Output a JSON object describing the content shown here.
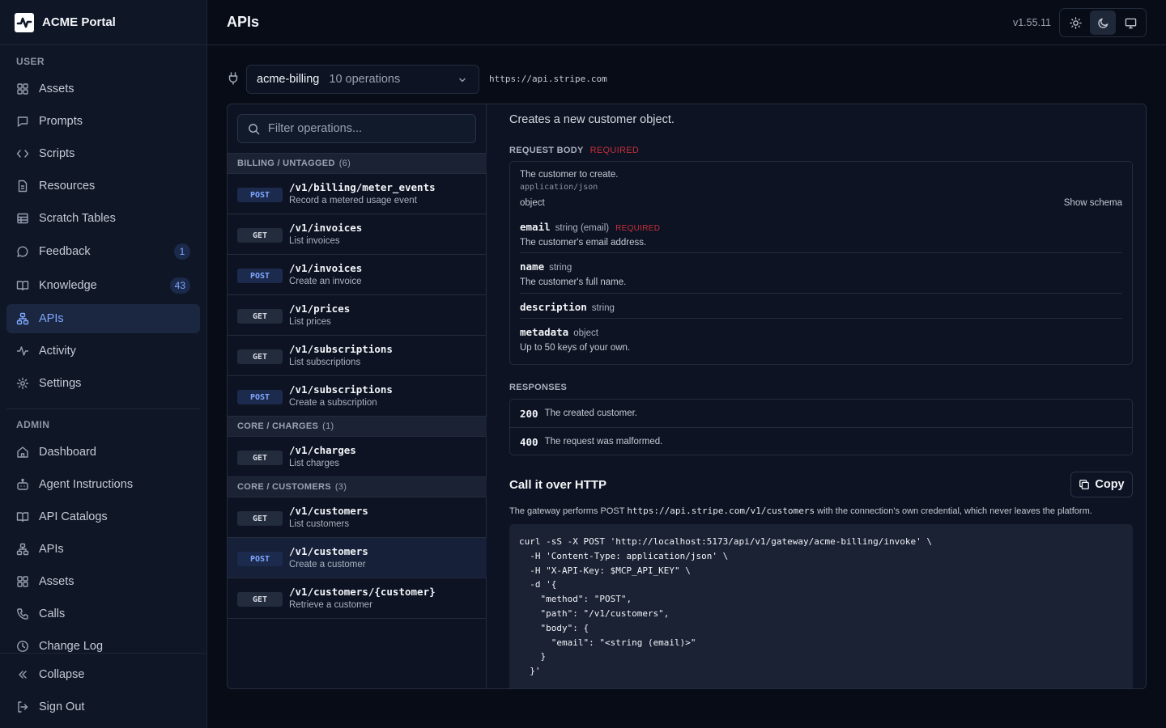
{
  "brand": {
    "name": "ACME Portal"
  },
  "sidebar": {
    "user_section": "USER",
    "admin_section": "ADMIN",
    "user_items": [
      {
        "label": "Assets",
        "icon": "grid-icon"
      },
      {
        "label": "Prompts",
        "icon": "message-icon"
      },
      {
        "label": "Scripts",
        "icon": "code-icon"
      },
      {
        "label": "Resources",
        "icon": "file-icon"
      },
      {
        "label": "Scratch Tables",
        "icon": "table-icon"
      },
      {
        "label": "Feedback",
        "icon": "chat-icon",
        "badge": "1"
      },
      {
        "label": "Knowledge",
        "icon": "book-icon",
        "badge": "43"
      },
      {
        "label": "APIs",
        "icon": "network-icon",
        "active": true
      },
      {
        "label": "Activity",
        "icon": "activity-icon"
      },
      {
        "label": "Settings",
        "icon": "gear-icon"
      }
    ],
    "admin_items": [
      {
        "label": "Dashboard",
        "icon": "home-icon"
      },
      {
        "label": "Agent Instructions",
        "icon": "bot-icon"
      },
      {
        "label": "API Catalogs",
        "icon": "book-icon"
      },
      {
        "label": "APIs",
        "icon": "network-icon"
      },
      {
        "label": "Assets",
        "icon": "grid-icon"
      },
      {
        "label": "Calls",
        "icon": "phone-icon"
      },
      {
        "label": "Change Log",
        "icon": "clock-icon"
      }
    ],
    "collapse_label": "Collapse",
    "signout_label": "Sign Out"
  },
  "header": {
    "title": "APIs",
    "version": "v1.55.11"
  },
  "toolbar": {
    "api_name": "acme-billing",
    "op_count": "10 operations",
    "base_url": "https://api.stripe.com"
  },
  "filter": {
    "placeholder": "Filter operations..."
  },
  "groups": [
    {
      "name": "BILLING / UNTAGGED",
      "count": "(6)"
    },
    {
      "name": "CORE / CHARGES",
      "count": "(1)"
    },
    {
      "name": "CORE / CUSTOMERS",
      "count": "(3)"
    }
  ],
  "operations": [
    {
      "method": "POST",
      "path": "/v1/billing/meter_events",
      "desc": "Record a metered usage event"
    },
    {
      "method": "GET",
      "path": "/v1/invoices",
      "desc": "List invoices"
    },
    {
      "method": "POST",
      "path": "/v1/invoices",
      "desc": "Create an invoice"
    },
    {
      "method": "GET",
      "path": "/v1/prices",
      "desc": "List prices"
    },
    {
      "method": "GET",
      "path": "/v1/subscriptions",
      "desc": "List subscriptions"
    },
    {
      "method": "POST",
      "path": "/v1/subscriptions",
      "desc": "Create a subscription"
    },
    {
      "method": "GET",
      "path": "/v1/charges",
      "desc": "List charges"
    },
    {
      "method": "GET",
      "path": "/v1/customers",
      "desc": "List customers"
    },
    {
      "method": "POST",
      "path": "/v1/customers",
      "desc": "Create a customer"
    },
    {
      "method": "GET",
      "path": "/v1/customers/{customer}",
      "desc": "Retrieve a customer"
    }
  ],
  "detail": {
    "summary": "Creates a new customer object.",
    "request_body_label": "REQUEST BODY",
    "required_label": "REQUIRED",
    "body_desc": "The customer to create.",
    "content_type": "application/json",
    "body_type": "object",
    "show_schema": "Show schema",
    "fields": [
      {
        "name": "email",
        "type": "string (email)",
        "required": "REQUIRED",
        "desc": "The customer's email address."
      },
      {
        "name": "name",
        "type": "string",
        "desc": "The customer's full name."
      },
      {
        "name": "description",
        "type": "string"
      },
      {
        "name": "metadata",
        "type": "object",
        "desc": "Up to 50 keys of your own."
      }
    ],
    "responses_label": "RESPONSES",
    "responses": [
      {
        "code": "200",
        "desc": "The created customer."
      },
      {
        "code": "400",
        "desc": "The request was malformed."
      }
    ],
    "http_title": "Call it over HTTP",
    "copy_label": "Copy",
    "note_prefix": "The gateway performs POST",
    "note_url": "https://api.stripe.com/v1/customers",
    "note_suffix": "with the connection's own credential, which never leaves the platform.",
    "curl": "curl -sS -X POST 'http://localhost:5173/api/v1/gateway/acme-billing/invoke' \\\n  -H 'Content-Type: application/json' \\\n  -H \"X-API-Key: $MCP_API_KEY\" \\\n  -d '{\n    \"method\": \"POST\",\n    \"path\": \"/v1/customers\",\n    \"body\": {\n      \"email\": \"<string (email)>\"\n    }\n  }'"
  },
  "colors": {
    "accent": "#7fa6ff",
    "required": "#c62f3a",
    "background": "#080c17"
  }
}
